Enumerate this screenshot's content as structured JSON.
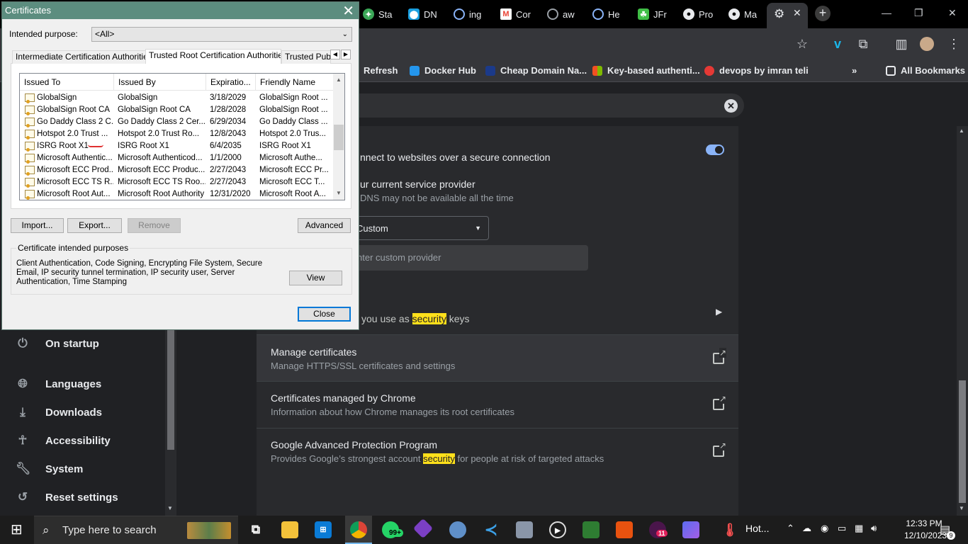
{
  "browser": {
    "tabs": [
      {
        "label": "Sta",
        "icon": "green-leaf-icon",
        "color": "#3aa757"
      },
      {
        "label": "DN",
        "icon": "location-pin-icon",
        "color": "#1aa0e0"
      },
      {
        "label": "ing",
        "icon": "spiral-icon",
        "color": "#8ab4f8"
      },
      {
        "label": "Cor",
        "icon": "gmail-icon",
        "color": "#ea4335"
      },
      {
        "label": "aw",
        "icon": "github-copilot-icon",
        "color": "#9aa0a6"
      },
      {
        "label": "He",
        "icon": "spiral-icon",
        "color": "#8ab4f8"
      },
      {
        "label": "JFr",
        "icon": "frog-icon",
        "color": "#40be46"
      },
      {
        "label": "Pro",
        "icon": "github-icon",
        "color": "#e8eaed"
      },
      {
        "label": "Ma",
        "icon": "github-icon",
        "color": "#e8eaed"
      }
    ],
    "bookmarks": [
      {
        "label": "Refresh",
        "color": "#ffffff"
      },
      {
        "label": "Docker Hub",
        "color": "#2496ed"
      },
      {
        "label": "Cheap Domain Na...",
        "color": "#1b3a8a"
      },
      {
        "label": "Key-based authenti...",
        "color": "#00a4ef"
      },
      {
        "label": "devops by imran teli",
        "color": "#e53935"
      },
      {
        "label": "All Bookmarks",
        "color": "#e8eaed"
      }
    ],
    "bookmarks_overflow": "»"
  },
  "settings": {
    "sidebar": [
      {
        "label": "On startup",
        "icon": "power-icon"
      },
      {
        "label": "Languages",
        "icon": "globe-icon"
      },
      {
        "label": "Downloads",
        "icon": "download-icon"
      },
      {
        "label": "Accessibility",
        "icon": "accessibility-icon"
      },
      {
        "label": "System",
        "icon": "wrench-icon"
      },
      {
        "label": "Reset settings",
        "icon": "history-icon"
      }
    ],
    "secure_dns_desc": "nnect to websites over a secure connection",
    "provider_title": "ur current service provider",
    "provider_sub": "DNS may not be available all the time",
    "provider_select": "Custom",
    "custom_placeholder": "nter custom provider",
    "security_keys_pre": "you use as",
    "security_keys_hl": "security",
    "security_keys_post": "keys",
    "manage_cert_title": "Manage certificates",
    "manage_cert_sub": "Manage HTTPS/SSL certificates and settings",
    "chrome_cert_title": "Certificates managed by Chrome",
    "chrome_cert_sub": "Information about how Chrome manages its root certificates",
    "gapp_title": "Google Advanced Protection Program",
    "gapp_sub_pre": "Provides Google’s strongest account",
    "gapp_sub_hl": "security",
    "gapp_sub_post": "for people at risk of targeted attacks"
  },
  "dialog": {
    "title": "Certificates",
    "close_glyph": "✕",
    "purpose_label": "Intended purpose:",
    "purpose_value": "<All>",
    "tabs": [
      "Intermediate Certification Authorities",
      "Trusted Root Certification Authorities",
      "Trusted Publ"
    ],
    "columns": [
      "Issued To",
      "Issued By",
      "Expiratio...",
      "Friendly Name"
    ],
    "rows": [
      [
        "GlobalSign",
        "GlobalSign",
        "3/18/2029",
        "GlobalSign Root ..."
      ],
      [
        "GlobalSign Root CA",
        "GlobalSign Root CA",
        "1/28/2028",
        "GlobalSign Root ..."
      ],
      [
        "Go Daddy Class 2 C...",
        "Go Daddy Class 2 Cer...",
        "6/29/2034",
        "Go Daddy Class ..."
      ],
      [
        "Hotspot 2.0 Trust ...",
        "Hotspot 2.0 Trust Ro...",
        "12/8/2043",
        "Hotspot 2.0 Trus..."
      ],
      [
        "ISRG Root X1",
        "ISRG Root X1",
        "6/4/2035",
        "ISRG Root X1"
      ],
      [
        "Microsoft Authentic...",
        "Microsoft Authenticod...",
        "1/1/2000",
        "Microsoft Authe..."
      ],
      [
        "Microsoft ECC Prod...",
        "Microsoft ECC Produc...",
        "2/27/2043",
        "Microsoft ECC Pr..."
      ],
      [
        "Microsoft ECC TS R...",
        "Microsoft ECC TS Roo...",
        "2/27/2043",
        "Microsoft ECC T..."
      ],
      [
        "Microsoft Root Aut...",
        "Microsoft Root Authority",
        "12/31/2020",
        "Microsoft Root A..."
      ]
    ],
    "buttons": {
      "import": "Import...",
      "export": "Export...",
      "remove": "Remove",
      "advanced": "Advanced",
      "view": "View",
      "close": "Close"
    },
    "purposes_title": "Certificate intended purposes",
    "purposes_text": "Client Authentication, Code Signing, Encrypting File System, Secure Email, IP security tunnel termination, IP security user, Server Authentication, Time Stamping"
  },
  "taskbar": {
    "search_placeholder": "Type here to search",
    "whatsapp_badge": "99+",
    "slack_badge": "11",
    "weather_label": "Hot...",
    "time": "12:33 PM",
    "date": "12/10/2023",
    "notification_count": "9"
  }
}
